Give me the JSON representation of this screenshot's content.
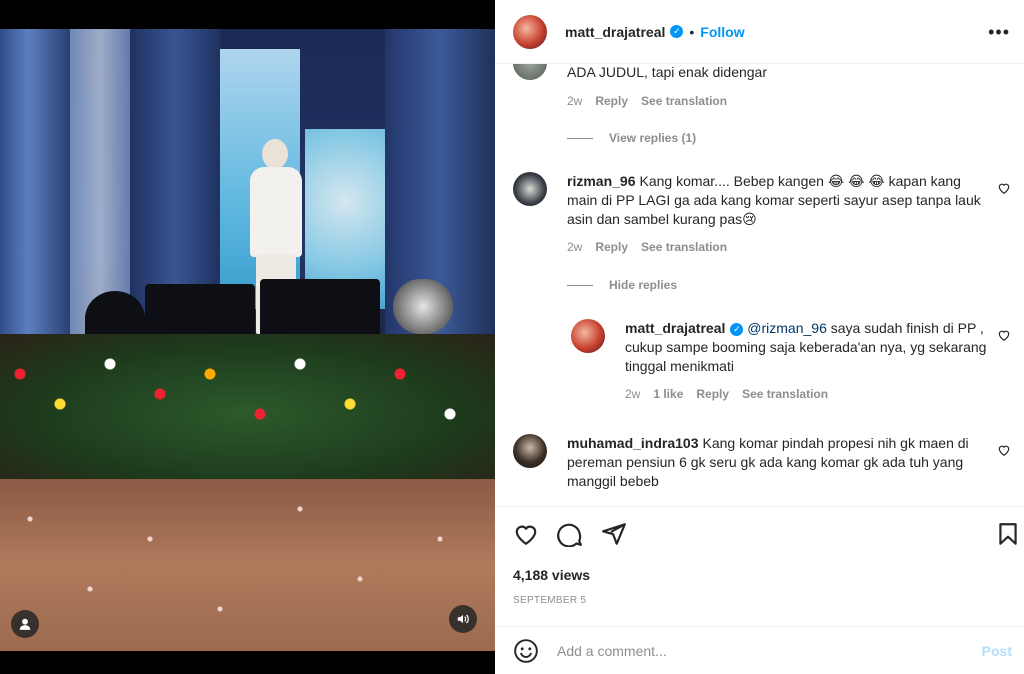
{
  "post": {
    "username": "matt_drajatreal",
    "follow_label": "Follow",
    "separator": "•",
    "more_label": "•••"
  },
  "comments": [
    {
      "text": "ADA JUDUL, tapi enak didengar",
      "time": "2w",
      "reply_label": "Reply",
      "translate_label": "See translation",
      "replies_toggle": "View replies (1)"
    },
    {
      "username": "rizman_96",
      "text": "Kang komar.... Bebep kangen 😂 😂 😂  kapan kang main di PP LAGI ga ada kang komar seperti sayur asep tanpa lauk asin dan sambel kurang pas😢",
      "time": "2w",
      "reply_label": "Reply",
      "translate_label": "See translation",
      "replies_toggle": "Hide replies",
      "reply": {
        "username": "matt_drajatreal",
        "mention": "@rizman_96",
        "text": " saya sudah finish di PP , cukup sampe booming saja keberada'an nya, yg sekarang tinggal menikmati",
        "time": "2w",
        "likes": "1 like",
        "reply_label": "Reply",
        "translate_label": "See translation"
      }
    },
    {
      "username": "muhamad_indra103",
      "text": "Kang komar pindah propesi nih gk maen di pereman pensiun 6 gk seru gk ada kang komar gk ada tuh yang manggil bebeb"
    }
  ],
  "stats": {
    "views": "4,188 views",
    "date": "SEPTEMBER 5"
  },
  "composer": {
    "placeholder": "Add a comment...",
    "post_label": "Post"
  },
  "colors": {
    "accent": "#0095f6",
    "muted": "#8e8e8e",
    "post_disabled": "#b2dffc"
  }
}
